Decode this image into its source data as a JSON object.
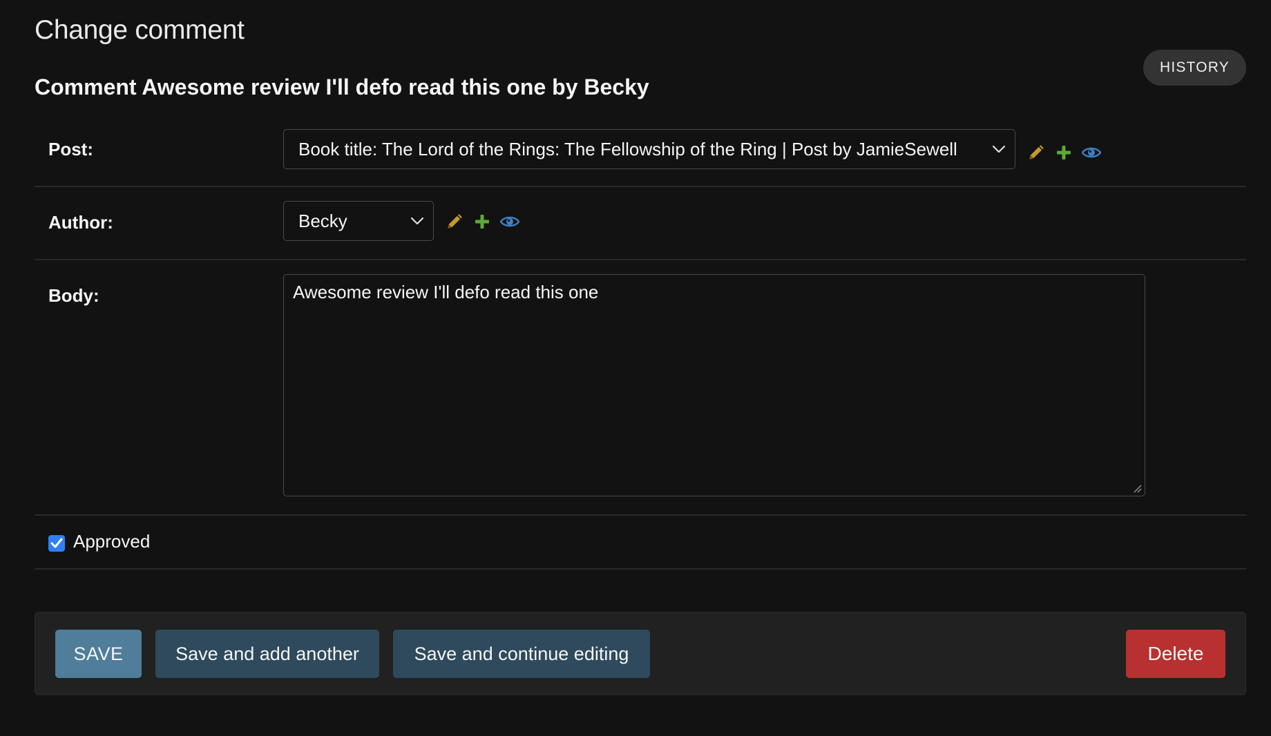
{
  "page": {
    "title": "Change comment",
    "object_title": "Comment Awesome review I'll defo read this one by Becky"
  },
  "toolbar": {
    "history_label": "HISTORY"
  },
  "form": {
    "post": {
      "label": "Post:",
      "selected": "Book title: The Lord of the Rings: The Fellowship of the Ring | Post by JamieSewell"
    },
    "author": {
      "label": "Author:",
      "selected": "Becky"
    },
    "body": {
      "label": "Body:",
      "value": "Awesome review I'll defo read this one"
    },
    "approved": {
      "label": "Approved",
      "checked": true
    }
  },
  "related_icons": [
    "pencil-icon",
    "plus-icon",
    "eye-icon"
  ],
  "submit": {
    "save_label": "SAVE",
    "save_add_label": "Save and add another",
    "save_continue_label": "Save and continue editing",
    "delete_label": "Delete"
  },
  "colors": {
    "background": "#121212",
    "save": "#4f7d9a",
    "secondary": "#2e4a5c",
    "delete": "#b8302f",
    "pencil": "#c49a2c",
    "plus": "#5fa83b",
    "eye": "#3f7fc0",
    "checkbox": "#2f7ff6"
  }
}
